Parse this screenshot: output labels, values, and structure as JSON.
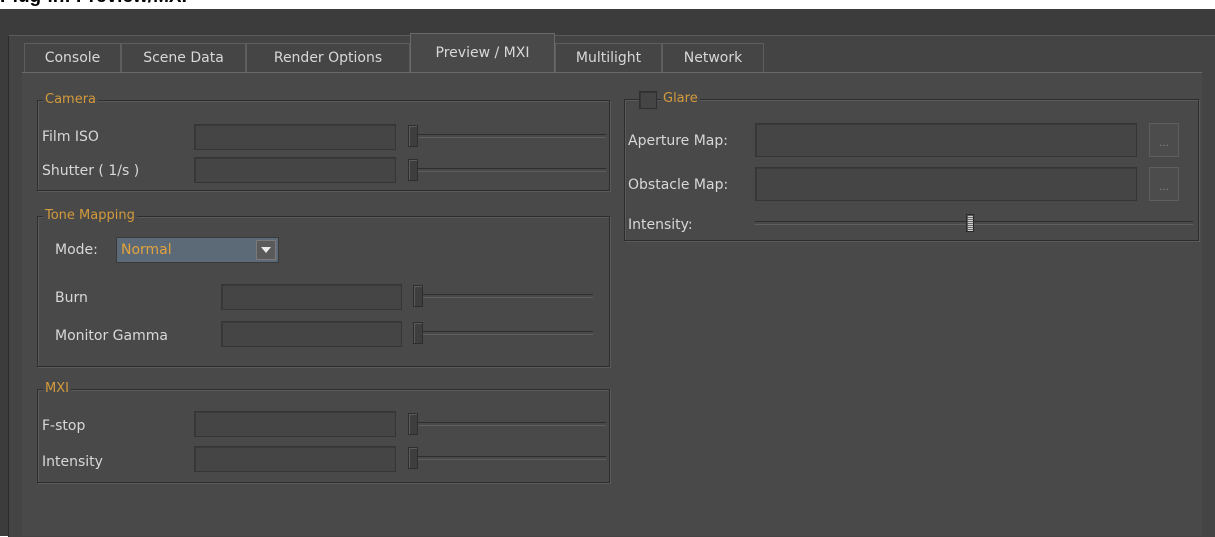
{
  "window": {
    "title": "Plug-in: Preview/MXI"
  },
  "tabs": [
    {
      "label": "Console"
    },
    {
      "label": "Scene Data"
    },
    {
      "label": "Render Options"
    },
    {
      "label": "Preview / MXI",
      "active": true
    },
    {
      "label": "Multilight"
    },
    {
      "label": "Network"
    }
  ],
  "camera": {
    "legend": "Camera",
    "film_iso": {
      "label": "Film ISO",
      "value": ""
    },
    "shutter": {
      "label": "Shutter ( 1/s )",
      "value": ""
    }
  },
  "tone_mapping": {
    "legend": "Tone Mapping",
    "mode_label": "Mode:",
    "mode_value": "Normal",
    "burn": {
      "label": "Burn",
      "value": ""
    },
    "monitor_gamma": {
      "label": "Monitor Gamma",
      "value": ""
    }
  },
  "mxi": {
    "legend": "MXI",
    "fstop": {
      "label": "F-stop",
      "value": ""
    },
    "intensity": {
      "label": "Intensity",
      "value": ""
    }
  },
  "glare": {
    "legend": "Glare",
    "enabled": false,
    "aperture_map": {
      "label": "Aperture Map:",
      "value": "",
      "browse": "..."
    },
    "obstacle_map": {
      "label": "Obstacle Map:",
      "value": "",
      "browse": "..."
    },
    "intensity": {
      "label": "Intensity:",
      "level": 0.49
    }
  },
  "colors": {
    "accent": "#d49a3c",
    "background": "#494949",
    "select_bg": "#5c6a78"
  }
}
